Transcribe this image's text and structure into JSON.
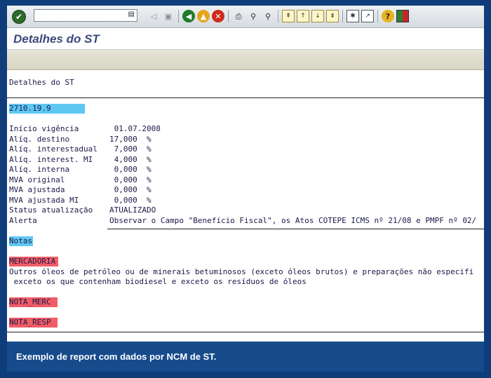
{
  "toolbar": {
    "command_field_value": "",
    "icons": [
      "enter-icon",
      "history-dropdown-icon",
      "back-nav-icon",
      "save-icon",
      "back-icon",
      "exit-icon",
      "cancel-icon",
      "print-icon",
      "find-icon",
      "find-next-icon",
      "first-page-icon",
      "previous-page-icon",
      "next-page-icon",
      "last-page-icon",
      "create-session-icon",
      "shortcut-icon",
      "help-icon",
      "layout-icon"
    ],
    "colors": {
      "green": "#1f7a28",
      "yellow": "#e4a51c",
      "red": "#d02a1e"
    }
  },
  "title": "Detalhes do ST",
  "report": {
    "heading": "Detalhes do ST",
    "ncm": "2710.19.9",
    "fields": [
      {
        "label": "Início vigência",
        "value": " 01.07.2008"
      },
      {
        "label": "Alíq. destino",
        "value": "17,000  %"
      },
      {
        "label": "Alíq. interestadual",
        "value": " 7,000  %"
      },
      {
        "label": "Alíq. interest. MI",
        "value": " 4,000  %"
      },
      {
        "label": "Alíq. interna",
        "value": " 0,000  %"
      },
      {
        "label": "MVA original",
        "value": " 0,000  %"
      },
      {
        "label": "MVA ajustada",
        "value": " 0,000  %"
      },
      {
        "label": "MVA ajustada MI",
        "value": " 0,000  %"
      },
      {
        "label": "Status atualização",
        "value": "ATUALIZADO"
      },
      {
        "label": "Alerta",
        "value": "Observar o Campo \"Benefício Fiscal\", os Atos COTEPE ICMS nº 21/08 e PMPF nº 02/"
      }
    ],
    "notes_header": "Notas",
    "merc_header": "MERCADORIA",
    "merc_line1": "Outros óleos de petróleo ou de minerais betuminosos (exceto óleos brutos) e preparações não especifi",
    "merc_line2": " exceto os que contenham biodiesel e exceto os resíduos de óleos",
    "nota_merc": "NOTA_MERC",
    "nota_resp": "NOTA_RESP",
    "highlight_colors": {
      "blue": "#5ec8f2",
      "red": "#f25c66"
    }
  },
  "caption": "Exemplo de report com dados por NCM de ST."
}
